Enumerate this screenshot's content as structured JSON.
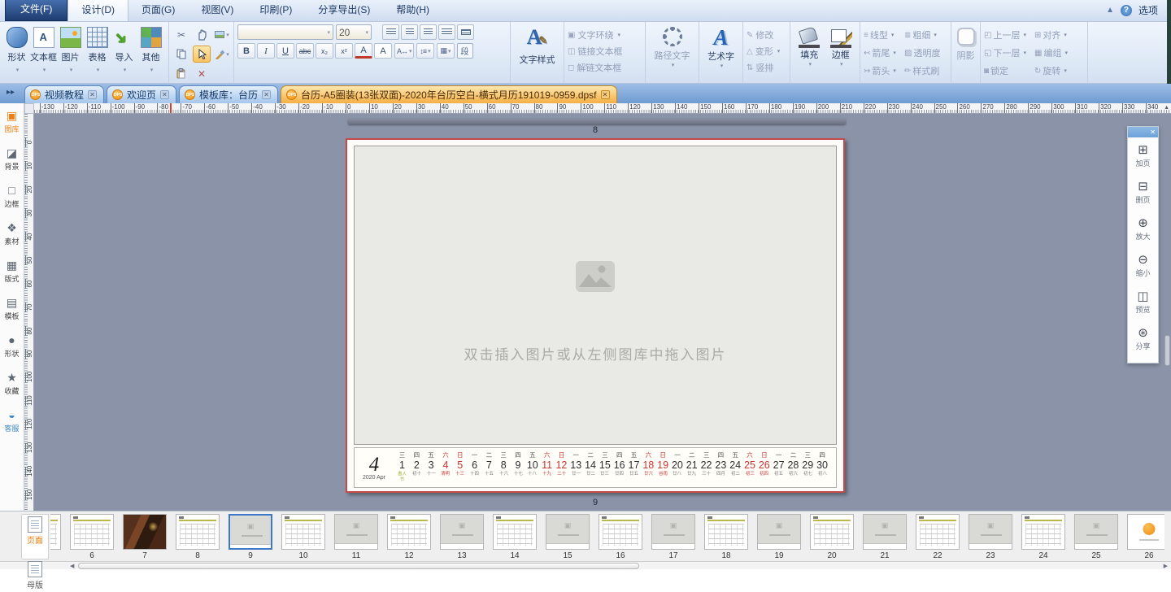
{
  "menu": {
    "items": [
      {
        "id": "file",
        "label": "文件(F)",
        "style": "file"
      },
      {
        "id": "design",
        "label": "设计(D)",
        "style": "active"
      },
      {
        "id": "page",
        "label": "页面(G)",
        "style": ""
      },
      {
        "id": "view",
        "label": "视图(V)",
        "style": ""
      },
      {
        "id": "print",
        "label": "印刷(P)",
        "style": ""
      },
      {
        "id": "share-export",
        "label": "分享导出(S)",
        "style": ""
      },
      {
        "id": "help",
        "label": "帮助(H)",
        "style": ""
      }
    ],
    "options_label": "选项"
  },
  "ribbon": {
    "insert": {
      "items": [
        {
          "id": "shape",
          "label": "形状",
          "icon": "shape-icon"
        },
        {
          "id": "textbox",
          "label": "文本框",
          "icon": "textbox-icon"
        },
        {
          "id": "picture",
          "label": "图片",
          "icon": "picture-icon"
        },
        {
          "id": "table",
          "label": "表格",
          "icon": "table-icon"
        },
        {
          "id": "import",
          "label": "导入",
          "icon": "import-icon"
        },
        {
          "id": "other",
          "label": "其他",
          "icon": "other-icon"
        }
      ]
    },
    "font": {
      "name_value": "",
      "size": "20",
      "buttons": [
        "B",
        "I",
        "U",
        "abc",
        "x₂",
        "x²",
        "A",
        "A"
      ],
      "paragraph": "段"
    },
    "text_style": "文字样式",
    "wrap_items": [
      {
        "id": "wrap",
        "label": "文字环绕",
        "icon": "wrap-text-icon",
        "caret": true
      },
      {
        "id": "link-frame",
        "label": "链接文本框",
        "icon": "link-frame-icon",
        "caret": false
      },
      {
        "id": "unlink-frame",
        "label": "解链文本框",
        "icon": "unlink-frame-icon",
        "caret": false
      }
    ],
    "path_text": "路径文字",
    "word_art": "艺术字",
    "modify_items": [
      {
        "id": "modify",
        "label": "修改",
        "icon": "modify-icon",
        "caret": false
      },
      {
        "id": "transform",
        "label": "变形",
        "icon": "transform-icon",
        "caret": true
      },
      {
        "id": "vertical",
        "label": "竖排",
        "icon": "vertical-text-icon",
        "caret": false
      }
    ],
    "fill": "填充",
    "border": "边框",
    "line_items": [
      {
        "id": "line-style",
        "label": "线型",
        "icon": "line-style-icon",
        "caret": true
      },
      {
        "id": "thickness",
        "label": "粗细",
        "icon": "thickness-icon",
        "caret": true
      },
      {
        "id": "arrow-tail",
        "label": "箭尾",
        "icon": "arrow-tail-icon",
        "caret": true
      },
      {
        "id": "transparency",
        "label": "透明度",
        "icon": "transparency-icon",
        "caret": false
      },
      {
        "id": "arrow-head",
        "label": "箭头",
        "icon": "arrow-head-icon",
        "caret": true
      },
      {
        "id": "style-brush",
        "label": "样式刷",
        "icon": "style-brush-icon",
        "caret": false
      }
    ],
    "shadow": "阴影",
    "arrange_items": [
      {
        "id": "bring-forward",
        "label": "上一层",
        "icon": "bring-forward-icon",
        "caret": true
      },
      {
        "id": "align",
        "label": "对齐",
        "icon": "align-icon",
        "caret": true
      },
      {
        "id": "send-backward",
        "label": "下一层",
        "icon": "send-backward-icon",
        "caret": true
      },
      {
        "id": "group",
        "label": "编组",
        "icon": "group-icon",
        "caret": true
      },
      {
        "id": "lock",
        "label": "锁定",
        "icon": "lock-icon",
        "caret": false
      },
      {
        "id": "rotate",
        "label": "旋转",
        "icon": "rotate-icon",
        "caret": true
      }
    ]
  },
  "tabs": {
    "items": [
      {
        "id": "video-tutorial",
        "label": "视频教程",
        "active": false
      },
      {
        "id": "welcome",
        "label": "欢迎页",
        "active": false
      },
      {
        "id": "template-lib",
        "label": "模板库：台历",
        "active": false
      },
      {
        "id": "document",
        "label": "台历-A5圈装(13张双面)-2020年台历空白-横式月历191019-0959.dpsf",
        "active": true
      }
    ]
  },
  "sidebar": {
    "items": [
      {
        "id": "gallery",
        "label": "图库",
        "icon": "gallery-icon",
        "active": true
      },
      {
        "id": "background",
        "label": "背景",
        "icon": "background-icon"
      },
      {
        "id": "frame",
        "label": "边框",
        "icon": "frame-icon"
      },
      {
        "id": "material",
        "label": "素材",
        "icon": "material-icon"
      },
      {
        "id": "layout",
        "label": "版式",
        "icon": "layout-icon"
      },
      {
        "id": "template",
        "label": "模板",
        "icon": "template-icon"
      },
      {
        "id": "shape",
        "label": "形状",
        "icon": "shape-blob-icon"
      },
      {
        "id": "favorite",
        "label": "收藏",
        "icon": "star-icon"
      },
      {
        "id": "service",
        "label": "客服",
        "icon": "chat-icon",
        "service": true
      }
    ]
  },
  "rulers": {
    "h": {
      "start": -130,
      "end": 340,
      "step": 10
    },
    "v": {
      "start": 0,
      "end": 150,
      "step": 10
    }
  },
  "canvas": {
    "prev_page_label": "8",
    "page_label": "9",
    "placeholder_text": "双击插入图片或从左侧图库中拖入图片"
  },
  "calendar": {
    "month": "4",
    "year_label": "2020 Apr",
    "days": [
      {
        "d": "1",
        "w": "三",
        "l": "愚人节",
        "c": "g"
      },
      {
        "d": "2",
        "w": "四",
        "l": "初十",
        "c": ""
      },
      {
        "d": "3",
        "w": "五",
        "l": "十一",
        "c": ""
      },
      {
        "d": "4",
        "w": "六",
        "l": "清明",
        "c": "r"
      },
      {
        "d": "5",
        "w": "日",
        "l": "十三",
        "c": "r"
      },
      {
        "d": "6",
        "w": "一",
        "l": "十四",
        "c": ""
      },
      {
        "d": "7",
        "w": "二",
        "l": "十五",
        "c": ""
      },
      {
        "d": "8",
        "w": "三",
        "l": "十六",
        "c": ""
      },
      {
        "d": "9",
        "w": "四",
        "l": "十七",
        "c": ""
      },
      {
        "d": "10",
        "w": "五",
        "l": "十八",
        "c": ""
      },
      {
        "d": "11",
        "w": "六",
        "l": "十九",
        "c": "r"
      },
      {
        "d": "12",
        "w": "日",
        "l": "二十",
        "c": "r"
      },
      {
        "d": "13",
        "w": "一",
        "l": "廿一",
        "c": ""
      },
      {
        "d": "14",
        "w": "二",
        "l": "廿二",
        "c": ""
      },
      {
        "d": "15",
        "w": "三",
        "l": "廿三",
        "c": ""
      },
      {
        "d": "16",
        "w": "四",
        "l": "廿四",
        "c": ""
      },
      {
        "d": "17",
        "w": "五",
        "l": "廿五",
        "c": ""
      },
      {
        "d": "18",
        "w": "六",
        "l": "廿六",
        "c": "r"
      },
      {
        "d": "19",
        "w": "日",
        "l": "谷雨",
        "c": "r"
      },
      {
        "d": "20",
        "w": "一",
        "l": "廿八",
        "c": ""
      },
      {
        "d": "21",
        "w": "二",
        "l": "廿九",
        "c": ""
      },
      {
        "d": "22",
        "w": "三",
        "l": "三十",
        "c": ""
      },
      {
        "d": "23",
        "w": "四",
        "l": "四月",
        "c": ""
      },
      {
        "d": "24",
        "w": "五",
        "l": "初二",
        "c": ""
      },
      {
        "d": "25",
        "w": "六",
        "l": "初三",
        "c": "r"
      },
      {
        "d": "26",
        "w": "日",
        "l": "初四",
        "c": "r"
      },
      {
        "d": "27",
        "w": "一",
        "l": "初五",
        "c": ""
      },
      {
        "d": "28",
        "w": "二",
        "l": "初六",
        "c": ""
      },
      {
        "d": "29",
        "w": "三",
        "l": "初七",
        "c": ""
      },
      {
        "d": "30",
        "w": "四",
        "l": "初八",
        "c": ""
      }
    ]
  },
  "panel": {
    "items": [
      {
        "id": "add-page",
        "label": "加页",
        "icon": "add-page-icon"
      },
      {
        "id": "delete-page",
        "label": "删页",
        "icon": "delete-page-icon"
      },
      {
        "id": "zoom-in",
        "label": "放大",
        "icon": "zoom-in-icon"
      },
      {
        "id": "zoom-out",
        "label": "缩小",
        "icon": "zoom-out-icon"
      },
      {
        "id": "preview",
        "label": "预览",
        "icon": "preview-icon"
      },
      {
        "id": "share",
        "label": "分享",
        "icon": "share-icon"
      }
    ]
  },
  "thumbs": {
    "page_btn": "页面",
    "master_btn": "母版",
    "items": [
      {
        "n": "",
        "t": "cal",
        "partial": true
      },
      {
        "n": "6",
        "t": "cal"
      },
      {
        "n": "7",
        "t": "photo"
      },
      {
        "n": "8",
        "t": "cal"
      },
      {
        "n": "9",
        "t": "ph",
        "sel": true
      },
      {
        "n": "10",
        "t": "cal"
      },
      {
        "n": "11",
        "t": "ph"
      },
      {
        "n": "12",
        "t": "cal"
      },
      {
        "n": "13",
        "t": "ph"
      },
      {
        "n": "14",
        "t": "cal"
      },
      {
        "n": "15",
        "t": "ph"
      },
      {
        "n": "16",
        "t": "cal"
      },
      {
        "n": "17",
        "t": "ph"
      },
      {
        "n": "18",
        "t": "cal"
      },
      {
        "n": "19",
        "t": "ph"
      },
      {
        "n": "20",
        "t": "cal"
      },
      {
        "n": "21",
        "t": "ph"
      },
      {
        "n": "22",
        "t": "cal"
      },
      {
        "n": "23",
        "t": "ph"
      },
      {
        "n": "24",
        "t": "cal"
      },
      {
        "n": "25",
        "t": "ph"
      },
      {
        "n": "26",
        "t": "logo"
      }
    ]
  },
  "colors": {
    "accent_orange": "#F29A1F",
    "tab_active": "#F5AF45",
    "canvas_bg": "#8A93A8",
    "page_border_red": "#C64949",
    "weekend_red": "#CC3333",
    "festival_green": "#98AC3C",
    "select_blue": "#3E78C8"
  }
}
